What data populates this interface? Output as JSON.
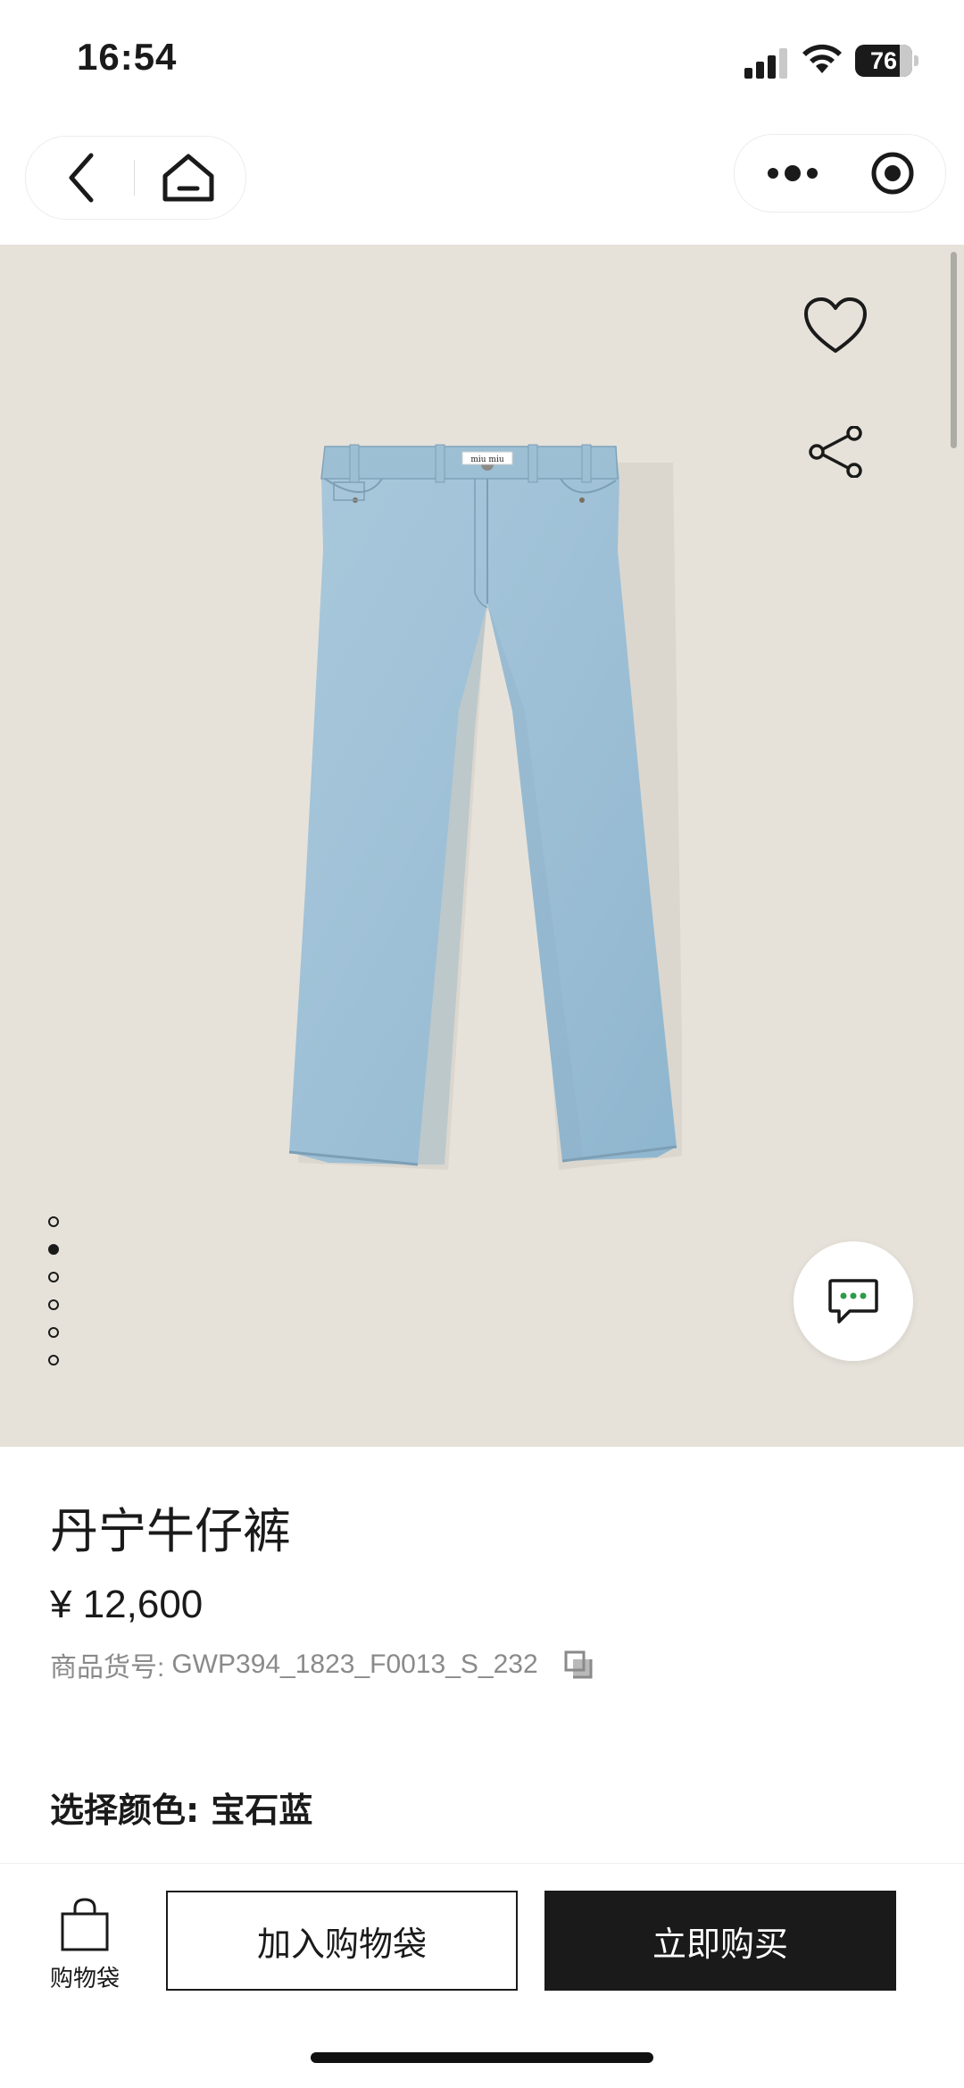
{
  "status_bar": {
    "time": "16:54",
    "battery": "76"
  },
  "product": {
    "title": "丹宁牛仔裤",
    "price": "¥ 12,600",
    "sku_label": "商品货号:",
    "sku_value": "GWP394_1823_F0013_S_232",
    "color_label": "选择颜色: 宝石蓝",
    "brand_tag": "miu miu"
  },
  "gallery": {
    "image_count": 6,
    "active_index": 1
  },
  "bottom_bar": {
    "bag_label": "购物袋",
    "add_to_bag": "加入购物袋",
    "buy_now": "立即购买"
  },
  "colors": {
    "accent": "#1a1a1a",
    "gallery_bg": "#e6e2da",
    "chat_dots": "#2e9b47"
  }
}
